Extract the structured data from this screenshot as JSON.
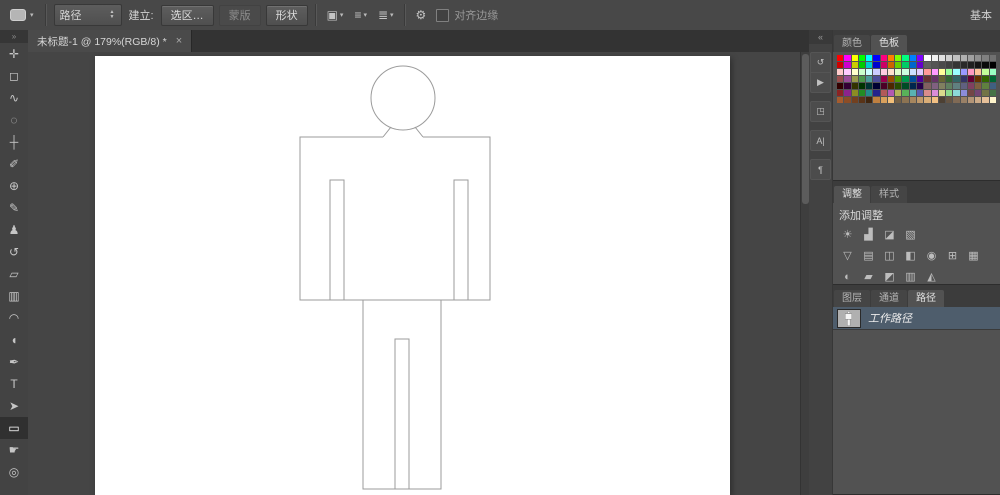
{
  "options_bar": {
    "mode_label": "路径",
    "make_label": "建立:",
    "make_buttons": [
      {
        "id": "selection",
        "label": "选区…",
        "enabled": true
      },
      {
        "id": "mask",
        "label": "蒙版",
        "enabled": false
      },
      {
        "id": "shape",
        "label": "形状",
        "enabled": true
      }
    ],
    "path_ops": [
      {
        "id": "path-operations",
        "glyph": "▣"
      },
      {
        "id": "path-alignment",
        "glyph": "≡"
      },
      {
        "id": "path-arrange",
        "glyph": "≣"
      }
    ],
    "align_edges_label": "对齐边缘",
    "workspace_label": "基本"
  },
  "icons": {
    "caret_down": "▾",
    "spinner": "▲▼",
    "gear": "⚙",
    "close": "×",
    "collapse_right": "»",
    "collapse_left": "«"
  },
  "document": {
    "tab_title": "未标题-1 @ 179%(RGB/8) *"
  },
  "tools": [
    {
      "id": "move",
      "glyph": "✛"
    },
    {
      "id": "marquee",
      "glyph": "◻"
    },
    {
      "id": "lasso",
      "glyph": "∿"
    },
    {
      "id": "quick-selection",
      "glyph": "◌"
    },
    {
      "id": "crop",
      "glyph": "┼"
    },
    {
      "id": "eyedropper",
      "glyph": "✐"
    },
    {
      "id": "healing-brush",
      "glyph": "⊕"
    },
    {
      "id": "brush",
      "glyph": "✎"
    },
    {
      "id": "clone-stamp",
      "glyph": "♟"
    },
    {
      "id": "history-brush",
      "glyph": "↺"
    },
    {
      "id": "eraser",
      "glyph": "▱"
    },
    {
      "id": "gradient",
      "glyph": "▥"
    },
    {
      "id": "blur",
      "glyph": "◠"
    },
    {
      "id": "dodge",
      "glyph": "◖"
    },
    {
      "id": "pen",
      "glyph": "✒"
    },
    {
      "id": "type",
      "glyph": "T"
    },
    {
      "id": "path-selection",
      "glyph": "➤"
    },
    {
      "id": "rectangle",
      "glyph": "▭",
      "active": true
    },
    {
      "id": "hand",
      "glyph": "☛"
    },
    {
      "id": "zoom",
      "glyph": "◎"
    }
  ],
  "panel_strip": {
    "groups": [
      [
        {
          "id": "history",
          "glyph": "↺"
        },
        {
          "id": "actions",
          "glyph": "▶"
        }
      ],
      [
        {
          "id": "properties",
          "glyph": "◳"
        }
      ],
      [
        {
          "id": "character",
          "glyph": "A|"
        }
      ],
      [
        {
          "id": "paragraph",
          "glyph": "¶"
        }
      ]
    ]
  },
  "color_panel": {
    "tabs": [
      {
        "id": "color",
        "label": "颜色"
      },
      {
        "id": "swatches",
        "label": "色板"
      }
    ],
    "active": "swatches",
    "swatches": [
      "#ff0000",
      "#ff00ff",
      "#ffff00",
      "#00ff00",
      "#00ffff",
      "#0000ff",
      "#ff0080",
      "#ff8000",
      "#80ff00",
      "#00ff80",
      "#0080ff",
      "#8000ff",
      "#ffffff",
      "#f0f0f0",
      "#e0e0e0",
      "#d0d0d0",
      "#c0c0c0",
      "#b0b0b0",
      "#a0a0a0",
      "#909090",
      "#808080",
      "#707070",
      "#cc0000",
      "#cc00cc",
      "#cccc00",
      "#00cc00",
      "#00cccc",
      "#0000cc",
      "#cc0066",
      "#cc6600",
      "#66cc00",
      "#00cc66",
      "#0066cc",
      "#6600cc",
      "#606060",
      "#555555",
      "#4a4a4a",
      "#404040",
      "#353535",
      "#2a2a2a",
      "#202020",
      "#151515",
      "#0a0a0a",
      "#000000",
      "#ffcccc",
      "#ffccff",
      "#ffffcc",
      "#ccffcc",
      "#ccffff",
      "#ccccff",
      "#ffcce0",
      "#ffe0cc",
      "#e0ffcc",
      "#ccffe0",
      "#cce0ff",
      "#e0ccff",
      "#ff9999",
      "#ff99ff",
      "#ffff99",
      "#99ff99",
      "#99ffff",
      "#9999ff",
      "#ff99c2",
      "#ffc299",
      "#c2ff99",
      "#99ffc2",
      "#994d4d",
      "#994d99",
      "#99994d",
      "#4d994d",
      "#4d9999",
      "#4d4d99",
      "#99004d",
      "#994d00",
      "#4d9900",
      "#00994d",
      "#004d99",
      "#4d0099",
      "#663333",
      "#663366",
      "#666633",
      "#336633",
      "#336666",
      "#333366",
      "#660033",
      "#663300",
      "#336600",
      "#006633",
      "#330000",
      "#330033",
      "#333300",
      "#003300",
      "#003333",
      "#000033",
      "#4c0026",
      "#4c2600",
      "#264c00",
      "#004c26",
      "#00264c",
      "#26004c",
      "#806060",
      "#806080",
      "#808060",
      "#608060",
      "#608080",
      "#606080",
      "#804060",
      "#806040",
      "#608040",
      "#406080",
      "#8c2323",
      "#8c238c",
      "#8c8c23",
      "#238c23",
      "#238c8c",
      "#23238c",
      "#b25959",
      "#b259b2",
      "#b2b259",
      "#59b259",
      "#59b2b2",
      "#5959b2",
      "#d98c8c",
      "#d98cd9",
      "#d9d98c",
      "#8cd98c",
      "#8cd9d9",
      "#8c8cd9",
      "#734646",
      "#734673",
      "#737346",
      "#467346",
      "#a65c2e",
      "#8c4d26",
      "#73401f",
      "#593317",
      "#40260f",
      "#bf8040",
      "#d9a05c",
      "#f2bf79",
      "#736046",
      "#8c7352",
      "#a6865e",
      "#bf996b",
      "#d9ad77",
      "#f2c083",
      "#4d4033",
      "#665544",
      "#806a55",
      "#998066",
      "#b39577",
      "#ccab88",
      "#e6c099",
      "#fff5cc"
    ]
  },
  "adjust_panel": {
    "tabs": [
      {
        "id": "adjustments",
        "label": "调整"
      },
      {
        "id": "styles",
        "label": "样式"
      }
    ],
    "active": "adjustments",
    "add_label": "添加调整",
    "icon_rows": [
      [
        {
          "id": "brightness-contrast",
          "glyph": "☀"
        },
        {
          "id": "levels",
          "glyph": "▟"
        },
        {
          "id": "curves",
          "glyph": "◪"
        },
        {
          "id": "exposure",
          "glyph": "▧"
        }
      ],
      [
        {
          "id": "vibrance",
          "glyph": "▽"
        },
        {
          "id": "hue-saturation",
          "glyph": "▤"
        },
        {
          "id": "color-balance",
          "glyph": "◫"
        },
        {
          "id": "black-white",
          "glyph": "◧"
        },
        {
          "id": "photo-filter",
          "glyph": "◉"
        },
        {
          "id": "channel-mixer",
          "glyph": "⊞"
        },
        {
          "id": "color-lookup",
          "glyph": "▦"
        }
      ],
      [
        {
          "id": "invert",
          "glyph": "◐"
        },
        {
          "id": "posterize",
          "glyph": "▰"
        },
        {
          "id": "threshold",
          "glyph": "◩"
        },
        {
          "id": "gradient-map",
          "glyph": "▥"
        },
        {
          "id": "selective-color",
          "glyph": "◭"
        }
      ]
    ]
  },
  "layers_panel": {
    "tabs": [
      {
        "id": "layers",
        "label": "图层"
      },
      {
        "id": "channels",
        "label": "通道"
      },
      {
        "id": "paths",
        "label": "路径"
      }
    ],
    "active": "paths",
    "work_path_label": "工作路径"
  }
}
